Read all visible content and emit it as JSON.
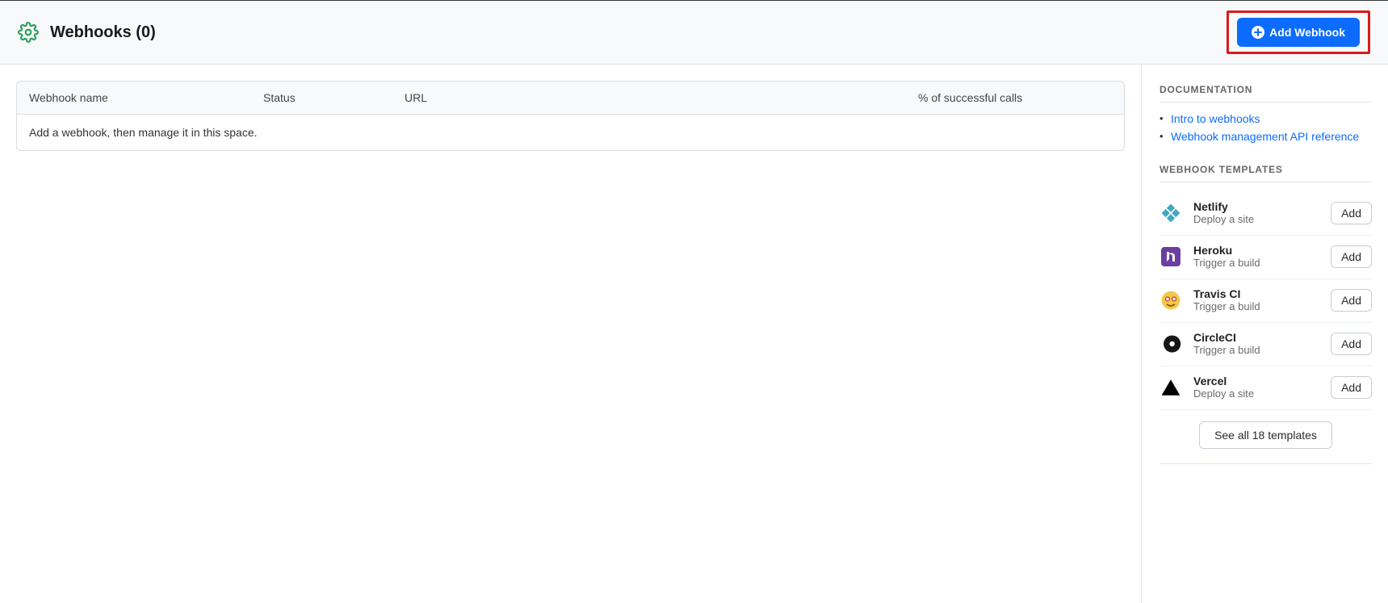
{
  "header": {
    "title": "Webhooks (0)",
    "add_button": "Add Webhook"
  },
  "table": {
    "columns": {
      "name": "Webhook name",
      "status": "Status",
      "url": "URL",
      "pct": "% of successful calls"
    },
    "empty_message": "Add a webhook, then manage it in this space."
  },
  "sidebar": {
    "documentation_title": "DOCUMENTATION",
    "doc_links": [
      {
        "label": "Intro to webhooks"
      },
      {
        "label": "Webhook management API reference"
      }
    ],
    "templates_title": "WEBHOOK TEMPLATES",
    "templates": [
      {
        "name": "Netlify",
        "desc": "Deploy a site",
        "add": "Add"
      },
      {
        "name": "Heroku",
        "desc": "Trigger a build",
        "add": "Add"
      },
      {
        "name": "Travis CI",
        "desc": "Trigger a build",
        "add": "Add"
      },
      {
        "name": "CircleCI",
        "desc": "Trigger a build",
        "add": "Add"
      },
      {
        "name": "Vercel",
        "desc": "Deploy a site",
        "add": "Add"
      }
    ],
    "see_all": "See all 18 templates"
  }
}
